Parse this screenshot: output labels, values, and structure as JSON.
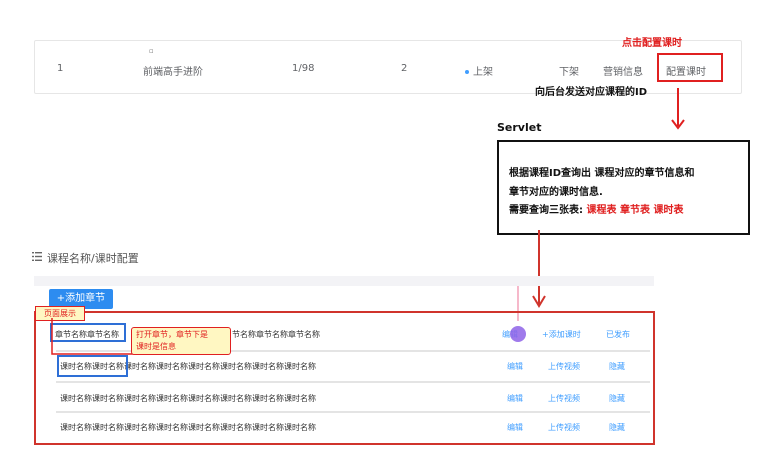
{
  "course_row": {
    "index": "1",
    "small_mark": "▫",
    "name": "前端高手进阶",
    "progress": "1/98",
    "count": "2",
    "status": "上架",
    "action_off_shelf": "下架",
    "action_marketing": "营销信息",
    "action_config_hours": "配置课时"
  },
  "annotations": {
    "click_config": "点击配置课时",
    "send_id": "向后台发送对应课程的ID",
    "servlet": "Servlet",
    "box_line1": "根据课程ID查询出 课程对应的章节信息和",
    "box_line2": "章节对应的课时信息.",
    "box_line3_prefix": "需要查询三张表: ",
    "box_line3_tables": "课程表 章节表 课时表",
    "page_show": "页面展示",
    "callout_line1": "打开章节，章节下是",
    "callout_line2": "课时是信息"
  },
  "page": {
    "title": "课程名称/课时配置",
    "add_chapter": "+添加章节"
  },
  "chapter_row": {
    "name_left": "章节名称章节名称",
    "name_right": "节名称章节名称章节名称",
    "edit": "编辑",
    "add_hour": "+添加课时",
    "publish": "已发布"
  },
  "hour_rows": [
    {
      "name_part1": "课时名称课",
      "name_part2": "时名称课时名称课时名称课时名称课时名称课时名称课时名称",
      "edit": "编辑",
      "upload": "上传视频",
      "hide": "隐藏"
    },
    {
      "name": "课时名称课时名称课时名称课时名称课时名称课时名称课时名称课时名称",
      "edit": "编辑",
      "upload": "上传视频",
      "hide": "隐藏"
    },
    {
      "name": "课时名称课时名称课时名称课时名称课时名称课时名称课时名称课时名称",
      "edit": "编辑",
      "upload": "上传视频",
      "hide": "隐藏"
    }
  ],
  "colors": {
    "primary": "#409eff",
    "danger": "#f56c6c",
    "annotation_red": "#e02020",
    "button_blue": "#2d8cf0"
  },
  "icons": [
    "menu-list-icon",
    "status-dot-icon",
    "arrow-down-icon",
    "cursor-dot-icon"
  ]
}
